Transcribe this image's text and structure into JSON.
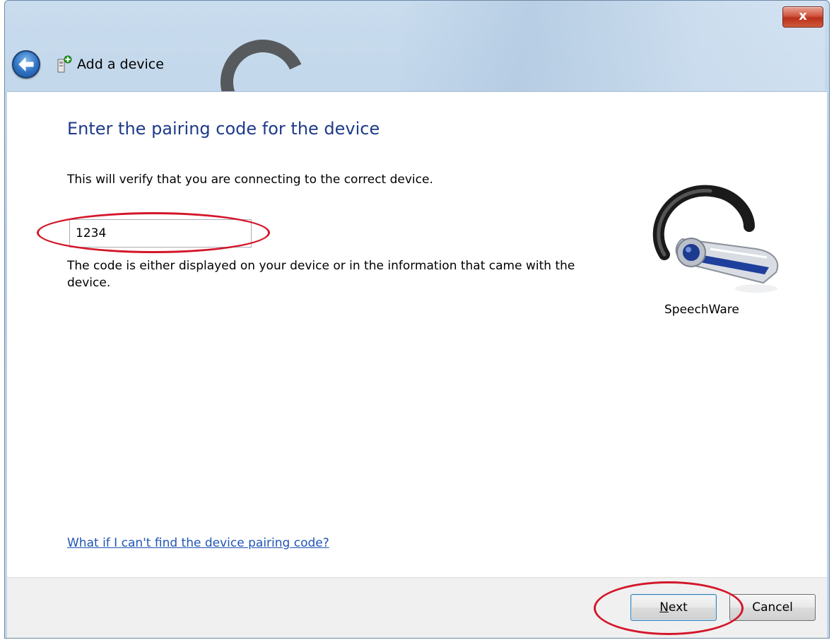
{
  "window": {
    "title": "Add a device",
    "close_glyph": "x"
  },
  "content": {
    "heading": "Enter the pairing code for the device",
    "description": "This will verify that you are connecting to the correct device.",
    "code_input_value": "1234",
    "hint": "The code is either displayed on your device or in the information that came with the device.",
    "device_name": "SpeechWare",
    "device_icon": "bluetooth-headset-icon",
    "help_link": "What if I can't find the device pairing code?"
  },
  "footer": {
    "next_first_letter": "N",
    "next_rest": "ext",
    "cancel_label": "Cancel"
  },
  "colors": {
    "heading": "#1e3b8a",
    "link": "#1f55b5",
    "highlight": "#d4162a"
  }
}
